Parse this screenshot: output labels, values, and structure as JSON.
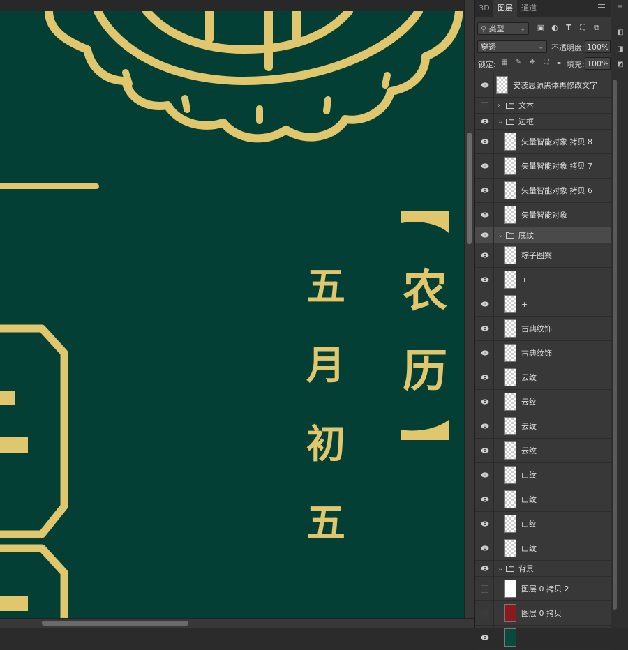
{
  "canvas": {
    "background": "#043f35",
    "gold": "#e0c76e",
    "vertical_text_1": [
      "五",
      "月",
      "初",
      "五"
    ],
    "bracket_text": [
      "农",
      "历"
    ]
  },
  "panel": {
    "tabs": [
      "3D",
      "图层",
      "通道"
    ],
    "active_tab": "图层",
    "filter_kind": "类型",
    "blend_mode": "穿透",
    "opacity_label": "不透明度:",
    "opacity_value": "100%",
    "lock_label": "锁定:",
    "fill_label": "填充:",
    "fill_value": "100%"
  },
  "layers": [
    {
      "name": "安装思源黑体再修改文字",
      "kind": "layer",
      "visible": true,
      "indent": 0
    },
    {
      "name": "文本",
      "kind": "group",
      "visible": false,
      "expanded": false,
      "indent": 0
    },
    {
      "name": "边框",
      "kind": "group",
      "visible": true,
      "expanded": true,
      "indent": 0
    },
    {
      "name": "矢量智能对象 拷贝 8",
      "kind": "layer",
      "visible": true,
      "indent": 1
    },
    {
      "name": "矢量智能对象 拷贝 7",
      "kind": "layer",
      "visible": true,
      "indent": 1
    },
    {
      "name": "矢量智能对象 拷贝 6",
      "kind": "layer",
      "visible": true,
      "indent": 1
    },
    {
      "name": "矢量智能对象",
      "kind": "layer",
      "visible": true,
      "indent": 1
    },
    {
      "name": "底纹",
      "kind": "group",
      "visible": true,
      "expanded": true,
      "indent": 0,
      "selected": true
    },
    {
      "name": "粽子图案",
      "kind": "layer",
      "visible": true,
      "indent": 1
    },
    {
      "name": "+",
      "kind": "layer",
      "visible": true,
      "indent": 1
    },
    {
      "name": "+",
      "kind": "layer",
      "visible": true,
      "indent": 1
    },
    {
      "name": "古典纹饰",
      "kind": "layer",
      "visible": true,
      "indent": 1
    },
    {
      "name": "古典纹饰",
      "kind": "layer",
      "visible": true,
      "indent": 1
    },
    {
      "name": "云纹",
      "kind": "layer",
      "visible": true,
      "indent": 1
    },
    {
      "name": "云纹",
      "kind": "layer",
      "visible": true,
      "indent": 1
    },
    {
      "name": "云纹",
      "kind": "layer",
      "visible": true,
      "indent": 1
    },
    {
      "name": "云纹",
      "kind": "layer",
      "visible": true,
      "indent": 1
    },
    {
      "name": "山纹",
      "kind": "layer",
      "visible": true,
      "indent": 1
    },
    {
      "name": "山纹",
      "kind": "layer",
      "visible": true,
      "indent": 1
    },
    {
      "name": "山纹",
      "kind": "layer",
      "visible": true,
      "indent": 1
    },
    {
      "name": "山纹",
      "kind": "layer",
      "visible": true,
      "indent": 1
    },
    {
      "name": "背景",
      "kind": "group",
      "visible": true,
      "expanded": true,
      "indent": 0
    },
    {
      "name": "图层 0 拷贝 2",
      "kind": "layer",
      "visible": false,
      "indent": 1,
      "thumb": "#ffffff"
    },
    {
      "name": "图层 0 拷贝",
      "kind": "layer",
      "visible": false,
      "indent": 1,
      "thumb": "#8b1a1e"
    },
    {
      "name": "",
      "kind": "layer",
      "visible": true,
      "indent": 1,
      "thumb": "#0a4a3c"
    }
  ]
}
